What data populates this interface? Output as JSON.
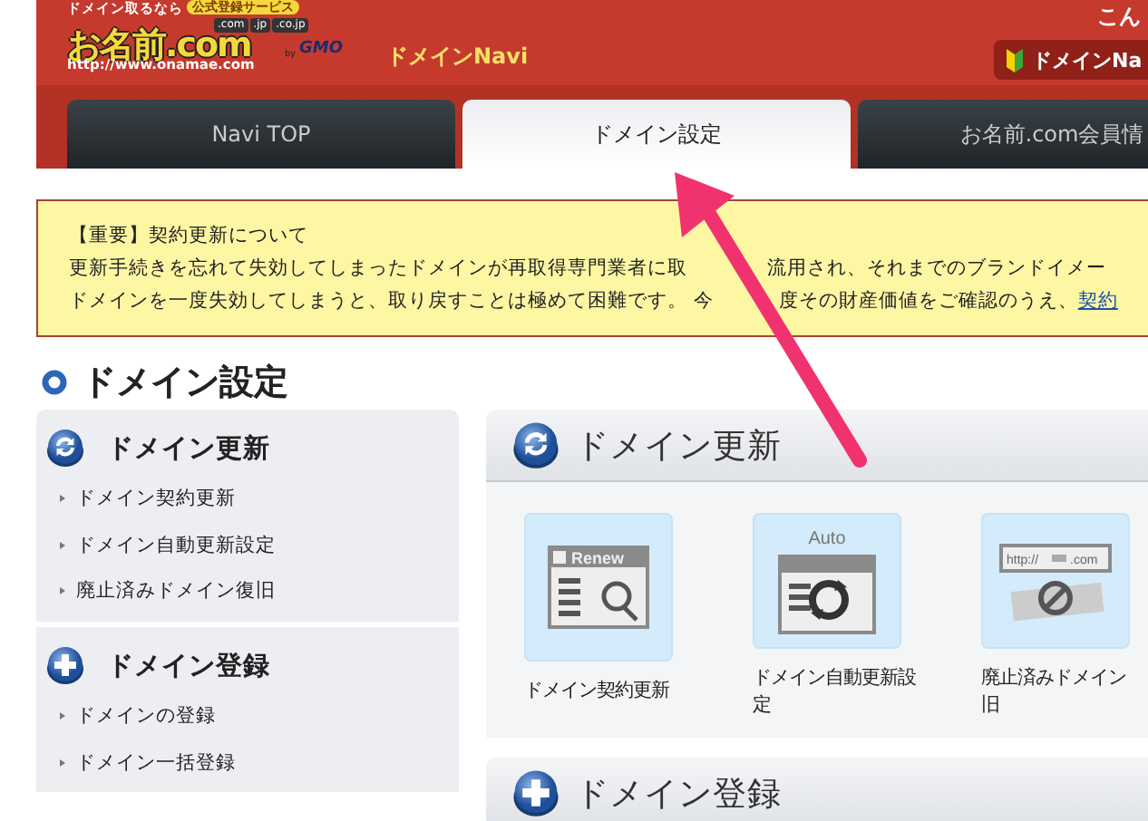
{
  "header": {
    "logo": {
      "tagline": "ドメイン取るなら",
      "badge": "公式登録サービス",
      "tlds": [
        ".com",
        ".jp",
        ".co.jp"
      ],
      "name": "お名前.com",
      "url": "http://www.onamae.com",
      "by": "by",
      "maker": "GMO"
    },
    "site_title": "ドメインNavi",
    "greeting": "こん",
    "navi_button": "ドメインNa"
  },
  "tabs": [
    {
      "label": "Navi TOP",
      "selected": false
    },
    {
      "label": "ドメイン設定",
      "selected": true
    },
    {
      "label": "お名前.com会員情",
      "selected": false
    }
  ],
  "notice": {
    "title": "【重要】契約更新について",
    "lines": [
      [
        "更新手続きを忘れて失効してしまったドメインが再取得専門業者に取",
        "流用され、それまでのブランドイメー"
      ],
      [
        "ドメインを一度失効してしまうと、取り戻すことは極めて困難です。 今",
        "度その財産価値をご確認のうえ、"
      ]
    ],
    "link": "契約"
  },
  "page_title": "ドメイン設定",
  "sidebar": {
    "sections": [
      {
        "kind": "renew",
        "title": "ドメイン更新",
        "items": [
          "ドメイン契約更新",
          "ドメイン自動更新設定",
          "廃止済みドメイン復旧"
        ]
      },
      {
        "kind": "register",
        "title": "ドメイン登録",
        "items": [
          "ドメインの登録",
          "ドメイン一括登録"
        ]
      }
    ]
  },
  "panels": [
    {
      "kind": "renew",
      "title": "ドメイン更新",
      "tiles": [
        {
          "kind": "renew",
          "captions": [
            "Renew"
          ],
          "label_lines": [
            "ドメイン契約更新"
          ]
        },
        {
          "kind": "auto",
          "captions": [
            "Auto"
          ],
          "label_lines": [
            "ドメイン自動更新設",
            "定"
          ]
        },
        {
          "kind": "restore",
          "captions": [
            "http://",
            ".com"
          ],
          "label_lines": [
            "廃止済みドメイン",
            "旧"
          ]
        }
      ]
    },
    {
      "kind": "register",
      "title": "ドメイン登録"
    }
  ]
}
